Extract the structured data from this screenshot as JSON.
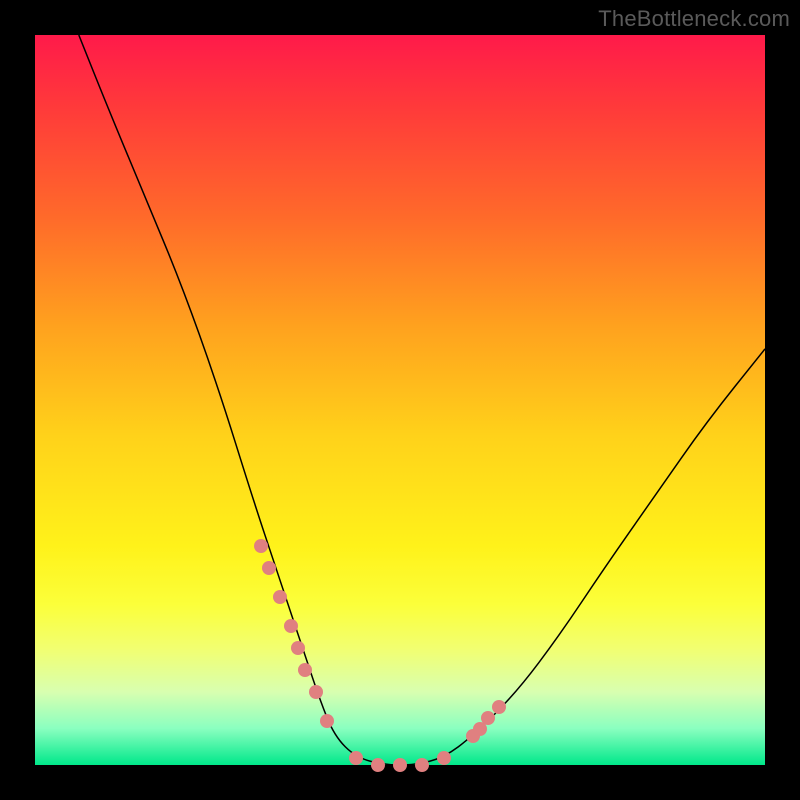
{
  "watermark": "TheBottleneck.com",
  "chart_data": {
    "type": "line",
    "title": "",
    "xlabel": "",
    "ylabel": "",
    "xlim": [
      0,
      100
    ],
    "ylim": [
      0,
      100
    ],
    "series": [
      {
        "name": "curve",
        "x": [
          6,
          10,
          15,
          20,
          25,
          30,
          33,
          35,
          37,
          39,
          41,
          44,
          48,
          52,
          56,
          60,
          66,
          72,
          78,
          85,
          92,
          100
        ],
        "y": [
          100,
          90,
          78,
          66,
          52,
          36,
          27,
          21,
          15,
          9,
          4,
          1,
          0,
          0,
          1,
          4,
          10,
          18,
          27,
          37,
          47,
          57
        ]
      }
    ],
    "points": {
      "name": "dots",
      "color": "#e08080",
      "x": [
        31,
        32,
        33.5,
        35,
        36,
        37,
        38.5,
        40,
        44,
        47,
        50,
        53,
        56,
        60,
        61,
        62,
        63.5
      ],
      "y": [
        30,
        27,
        23,
        19,
        16,
        13,
        10,
        6,
        1,
        0,
        0,
        0,
        1,
        4,
        5,
        6.5,
        8
      ]
    }
  }
}
